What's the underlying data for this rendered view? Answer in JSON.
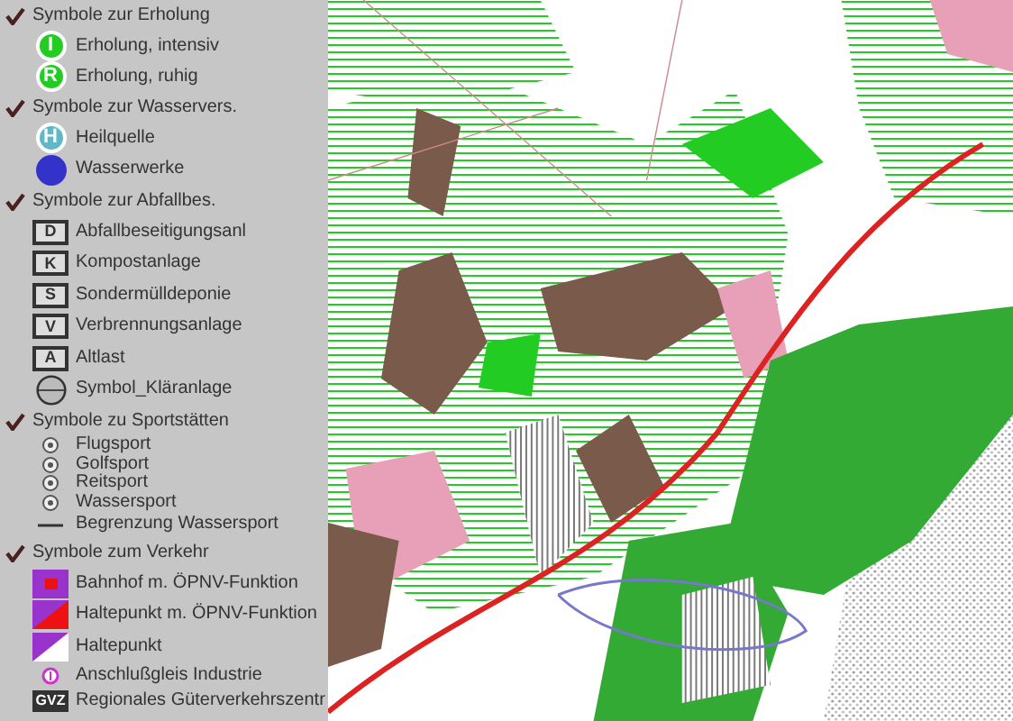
{
  "legend": {
    "groups": [
      {
        "title": "Symbole zur Erholung",
        "checked": true,
        "items": [
          {
            "kind": "circle-letter",
            "symbol": "I",
            "label": "Erholung, intensiv"
          },
          {
            "kind": "circle-letter",
            "symbol": "R",
            "label": "Erholung, ruhig"
          }
        ]
      },
      {
        "title": "Symbole zur Wasservers.",
        "checked": true,
        "items": [
          {
            "kind": "spring",
            "symbol": "H",
            "label": "Heilquelle"
          },
          {
            "kind": "waterworks",
            "label": "Wasserwerke"
          }
        ]
      },
      {
        "title": "Symbole zur Abfallbes.",
        "checked": true,
        "items": [
          {
            "kind": "box-letter",
            "symbol": "D",
            "label": "Abfallbeseitigungsanl"
          },
          {
            "kind": "box-letter",
            "symbol": "K",
            "label": "Kompostanlage"
          },
          {
            "kind": "box-letter",
            "symbol": "S",
            "label": "Sondermülldeponie"
          },
          {
            "kind": "box-letter",
            "symbol": "V",
            "label": "Verbrennungsanlage"
          },
          {
            "kind": "box-letter",
            "symbol": "A",
            "label": "Altlast"
          },
          {
            "kind": "clarifier",
            "label": "Symbol_Kläranlage"
          }
        ]
      },
      {
        "title": "Symbole zu Sportstätten",
        "checked": true,
        "items": [
          {
            "kind": "sport",
            "label": "Flugsport"
          },
          {
            "kind": "sport",
            "label": "Golfsport"
          },
          {
            "kind": "sport",
            "label": "Reitsport"
          },
          {
            "kind": "sport",
            "label": "Wassersport"
          },
          {
            "kind": "line",
            "label": "Begrenzung Wassersport"
          }
        ]
      },
      {
        "title": "Symbole zum Verkehr",
        "checked": true,
        "items": [
          {
            "kind": "station",
            "label": "Bahnhof m. ÖPNV-Funktion"
          },
          {
            "kind": "stop-transit",
            "label": "Haltepunkt m. ÖPNV-Funktion"
          },
          {
            "kind": "stop",
            "label": "Haltepunkt"
          },
          {
            "kind": "siding",
            "label": "Anschlußgleis Industrie"
          },
          {
            "kind": "freight",
            "symbol": "GVZ",
            "label": "Regionales Güterverkehrszentr"
          }
        ]
      }
    ]
  }
}
